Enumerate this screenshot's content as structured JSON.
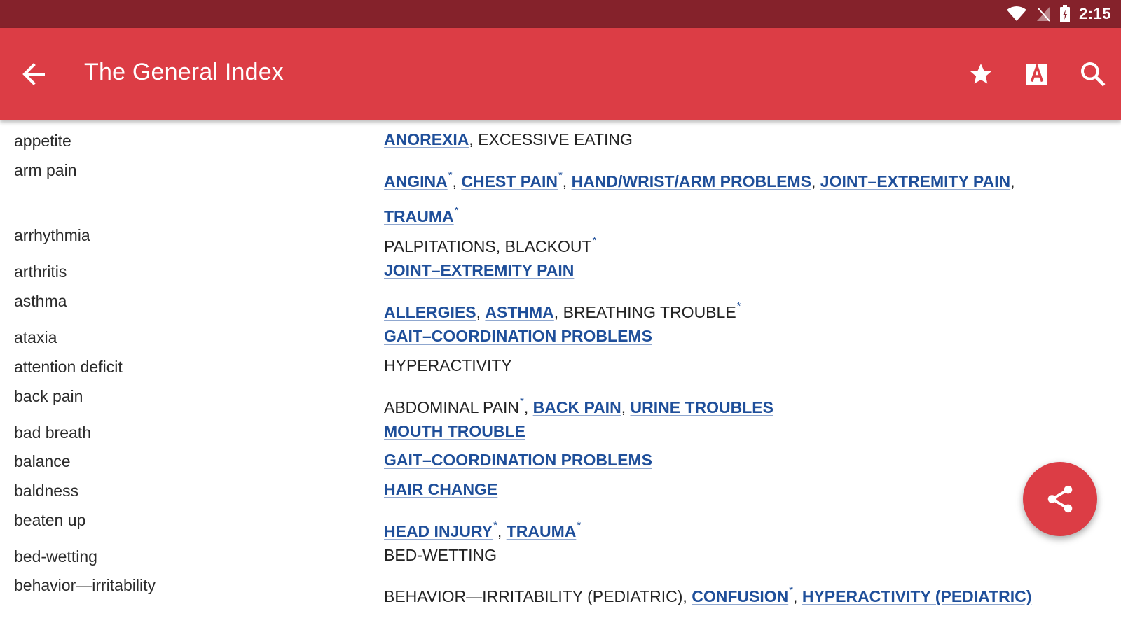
{
  "status_bar": {
    "time": "2:15"
  },
  "app_bar": {
    "title": "The General Index"
  },
  "icons": {
    "back": "arrow-left-icon",
    "favorite": "star-icon",
    "font": "font-size-icon",
    "search": "search-icon",
    "share": "share-icon"
  },
  "colors": {
    "status_bar": "#85222b",
    "app_bar": "#dc3d45",
    "link": "#1f4f9a",
    "fab": "#dc3d45"
  },
  "index": [
    {
      "term": "appetite",
      "refs": [
        {
          "text": "ANOREXIA",
          "link": true
        },
        {
          "text": ", ",
          "link": false
        },
        {
          "text": "EXCESSIVE EATING",
          "link": false
        }
      ]
    },
    {
      "term": "arm pain",
      "refs": [
        {
          "text": "ANGINA",
          "link": true,
          "star": "*"
        },
        {
          "text": ", ",
          "link": false
        },
        {
          "text": "CHEST PAIN",
          "link": true,
          "star": "*"
        },
        {
          "text": ", ",
          "link": false
        },
        {
          "text": "HAND/WRIST/ARM PROBLEMS",
          "link": true
        },
        {
          "text": ", ",
          "link": false
        },
        {
          "text": "JOINT–EXTREMITY PAIN",
          "link": true
        },
        {
          "text": ", ",
          "link": false
        },
        {
          "text": "TRAUMA",
          "link": true,
          "star": "*"
        }
      ]
    },
    {
      "term": "arrhythmia",
      "refs": [
        {
          "text": "PALPITATIONS, BLACKOUT",
          "link": false,
          "star": "*"
        }
      ]
    },
    {
      "term": "arthritis",
      "refs": [
        {
          "text": "JOINT–EXTREMITY PAIN",
          "link": true
        }
      ]
    },
    {
      "term": "asthma",
      "refs": [
        {
          "text": "ALLERGIES",
          "link": true
        },
        {
          "text": ", ",
          "link": false
        },
        {
          "text": "ASTHMA",
          "link": true
        },
        {
          "text": ", ",
          "link": false
        },
        {
          "text": "BREATHING TROUBLE",
          "link": false,
          "star": "*"
        }
      ]
    },
    {
      "term": "ataxia",
      "refs": [
        {
          "text": "GAIT–COORDINATION PROBLEMS",
          "link": true
        }
      ]
    },
    {
      "term": "attention deficit",
      "refs": [
        {
          "text": "HYPERACTIVITY",
          "link": false
        }
      ]
    },
    {
      "term": "back pain",
      "refs": [
        {
          "text": "ABDOMINAL PAIN",
          "link": false,
          "star": "*"
        },
        {
          "text": ", ",
          "link": false
        },
        {
          "text": "BACK PAIN",
          "link": true
        },
        {
          "text": ", ",
          "link": false
        },
        {
          "text": "URINE TROUBLES",
          "link": true
        }
      ]
    },
    {
      "term": "bad breath",
      "refs": [
        {
          "text": "MOUTH TROUBLE",
          "link": true
        }
      ]
    },
    {
      "term": "balance",
      "refs": [
        {
          "text": "GAIT–COORDINATION PROBLEMS",
          "link": true
        }
      ]
    },
    {
      "term": "baldness",
      "refs": [
        {
          "text": "HAIR CHANGE",
          "link": true
        }
      ]
    },
    {
      "term": "beaten up",
      "refs": [
        {
          "text": "HEAD INJURY",
          "link": true,
          "star": "*"
        },
        {
          "text": ", ",
          "link": false
        },
        {
          "text": "TRAUMA",
          "link": true,
          "star": "*"
        }
      ]
    },
    {
      "term": "bed-wetting",
      "refs": [
        {
          "text": "BED-WETTING",
          "link": false
        }
      ]
    },
    {
      "term": "behavior—irritability",
      "refs": [
        {
          "text": "BEHAVIOR—IRRITABILITY (PEDIATRIC)",
          "link": false
        },
        {
          "text": ", ",
          "link": false
        },
        {
          "text": "CONFUSION",
          "link": true,
          "star": "*"
        },
        {
          "text": ", ",
          "link": false
        },
        {
          "text": "HYPERACTIVITY (PEDIATRIC)",
          "link": true
        }
      ]
    }
  ]
}
